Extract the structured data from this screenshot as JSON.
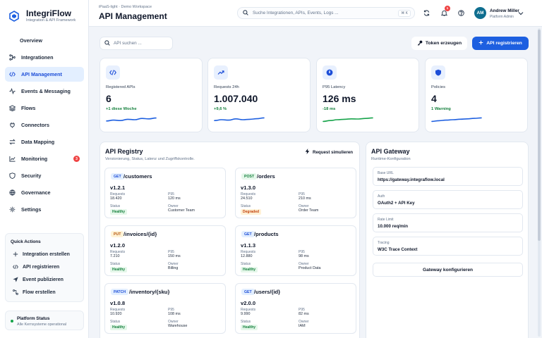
{
  "brand": {
    "name": "IntegriFlow",
    "subtitle": "Integration & API Framework"
  },
  "sidebar": {
    "overview": "Overview",
    "items": [
      {
        "label": "Integrationen",
        "icon": "tree-icon"
      },
      {
        "label": "API Management",
        "icon": "code-icon",
        "active": true
      },
      {
        "label": "Events & Messaging",
        "icon": "wave-icon"
      },
      {
        "label": "Flows",
        "icon": "layers-icon"
      },
      {
        "label": "Connectors",
        "icon": "plug-icon"
      },
      {
        "label": "Data Mapping",
        "icon": "swap-icon"
      },
      {
        "label": "Monitoring",
        "icon": "chart-icon",
        "badge": "3"
      },
      {
        "label": "Security",
        "icon": "shield-icon"
      },
      {
        "label": "Governance",
        "icon": "globe-icon"
      },
      {
        "label": "Settings",
        "icon": "gear-icon"
      }
    ]
  },
  "quick_actions": {
    "title": "Quick Actions",
    "items": [
      "Integration erstellen",
      "API registrieren",
      "Event publizieren",
      "Flow erstellen"
    ]
  },
  "platform_status": {
    "title": "Platform Status",
    "subtitle": "Alle Kernsysteme operational"
  },
  "header": {
    "breadcrumb": "iPaaS-light · Demo Workspace",
    "title": "API Management",
    "search_placeholder": "Suche Integrationen, APIs, Events, Logs ...",
    "search_shortcut": "⌘ K",
    "notification_count": "1",
    "user_initials": "AM",
    "user_name": "Andrew Miller",
    "user_role": "Platform Admin"
  },
  "toolbar": {
    "api_search_placeholder": "API suchen ...",
    "token_button": "Token erzeugen",
    "register_button": "API registrieren"
  },
  "kpis": [
    {
      "label": "Registered APIs",
      "value": "6",
      "delta": "+1 diese Woche",
      "icon": "code-icon",
      "spark": [
        0.35,
        0.45,
        0.4,
        0.55,
        0.5,
        0.65,
        0.6,
        0.7
      ]
    },
    {
      "label": "Requests 24h",
      "value": "1.007.040",
      "delta": "+9,6 %",
      "icon": "trend-up-icon",
      "spark": [
        0.4,
        0.5,
        0.45,
        0.6,
        0.5,
        0.55,
        0.62,
        0.72
      ]
    },
    {
      "label": "P95 Latency",
      "value": "126 ms",
      "delta": "-18 ms",
      "icon": "gauge-icon",
      "spark": [
        0.3,
        0.4,
        0.5,
        0.55,
        0.6,
        0.58,
        0.65,
        0.72
      ]
    },
    {
      "label": "Policies",
      "value": "4",
      "delta": "1 Warning",
      "icon": "shield-icon",
      "spark": [
        0.3,
        0.38,
        0.45,
        0.5,
        0.56,
        0.6,
        0.66,
        0.72
      ]
    }
  ],
  "registry": {
    "title": "API Registry",
    "subtitle": "Versionierung, Status, Latenz und Zugriffskontrolle.",
    "simulate_button": "Request simulieren",
    "labels": {
      "requests": "Requests",
      "p95": "P95",
      "status": "Status",
      "owner": "Owner"
    },
    "apis": [
      {
        "method": "GET",
        "path": "/customers",
        "version": "v1.2.1",
        "requests": "18.420",
        "p95": "120 ms",
        "status": "Healthy",
        "owner": "Customer Team"
      },
      {
        "method": "POST",
        "path": "/orders",
        "version": "v1.3.0",
        "requests": "24.510",
        "p95": "210 ms",
        "status": "Degraded",
        "owner": "Order Team"
      },
      {
        "method": "PUT",
        "path": "/invoices/{id}",
        "version": "v1.2.0",
        "requests": "7.210",
        "p95": "150 ms",
        "status": "Healthy",
        "owner": "Billing"
      },
      {
        "method": "GET",
        "path": "/products",
        "version": "v1.1.3",
        "requests": "12.880",
        "p95": "98 ms",
        "status": "Healthy",
        "owner": "Product Data"
      },
      {
        "method": "PATCH",
        "path": "/inventory/{sku}",
        "version": "v1.0.8",
        "requests": "10.920",
        "p95": "108 ms",
        "status": "Healthy",
        "owner": "Warehouse"
      },
      {
        "method": "GET",
        "path": "/users/{id}",
        "version": "v2.0.0",
        "requests": "9.990",
        "p95": "82 ms",
        "status": "Healthy",
        "owner": "IAM"
      }
    ]
  },
  "gateway": {
    "title": "API Gateway",
    "subtitle": "Runtime-Konfiguration",
    "fields": [
      {
        "label": "Base URL",
        "value": "https://gateway.integraflow.local"
      },
      {
        "label": "Auth",
        "value": "OAuth2 + API Key"
      },
      {
        "label": "Rate Limit",
        "value": "10.000 req/min"
      },
      {
        "label": "Tracing",
        "value": "W3C Trace Context"
      }
    ],
    "configure_button": "Gateway konfigurieren"
  },
  "colors": {
    "accent": "#1d5fe0",
    "success": "#15803d",
    "warning": "#c2410c",
    "danger": "#ef4444"
  }
}
